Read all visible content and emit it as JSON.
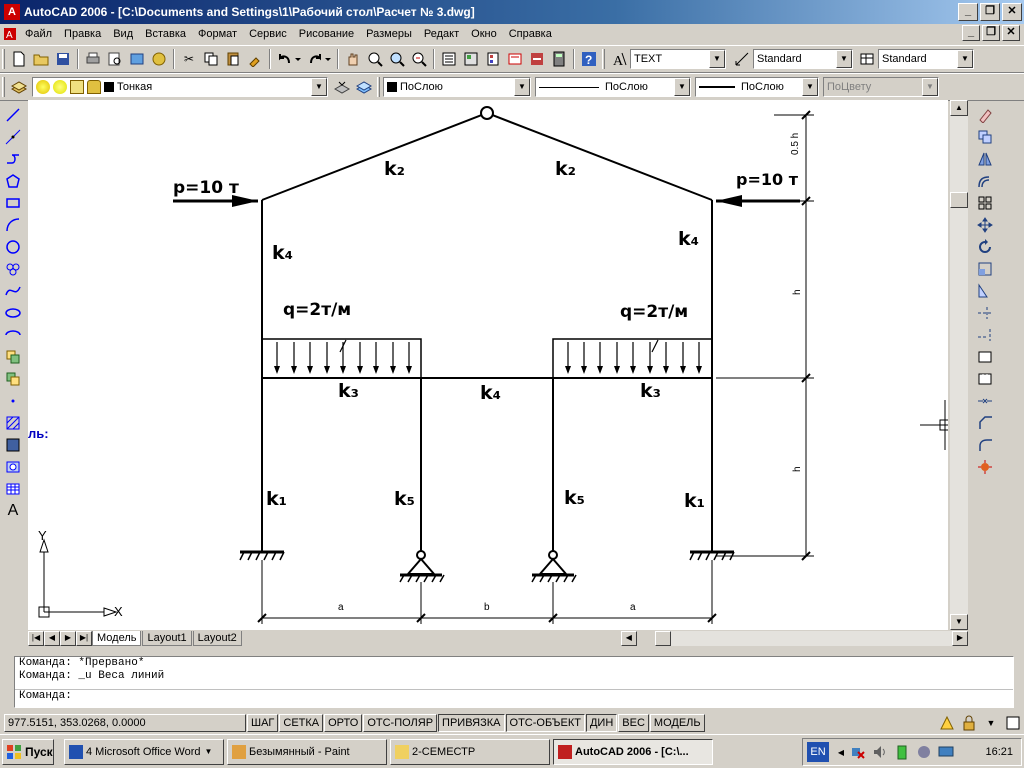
{
  "window": {
    "title": "AutoCAD 2006 - [C:\\Documents and Settings\\1\\Рабочий стол\\Расчет № 3.dwg]",
    "minimize": "_",
    "restore": "❐",
    "close": "✕"
  },
  "menu": [
    "Файл",
    "Правка",
    "Вид",
    "Вставка",
    "Формат",
    "Сервис",
    "Рисование",
    "Размеры",
    "Редакт",
    "Окно",
    "Справка"
  ],
  "toolbar": {
    "text_style": "TEXT",
    "dim_style": "Standard",
    "table_style": "Standard"
  },
  "layers": {
    "layer": "Тонкая",
    "color": "ПоСлою",
    "linetype": "ПоСлою",
    "lineweight": "ПоСлою",
    "plotstyle": "ПоЦвету"
  },
  "drawing": {
    "p_left": "p=10 т",
    "p_right": "p=10 т",
    "q_left": "q=2т/м",
    "q_right": "q=2т/м",
    "k2_left": "k₂",
    "k2_right": "k₂",
    "k4_left": "k₄",
    "k4_right": "k₄",
    "k4_mid": "k₄",
    "k3_left": "k₃",
    "k3_right": "k₃",
    "k1_left": "k₁",
    "k1_right": "k₁",
    "k5_left": "k₅",
    "k5_right": "k₅",
    "dim_05h": "0.5 h",
    "dim_h1": "h",
    "dim_h2": "h",
    "dim_a1": "a",
    "dim_b": "b",
    "dim_a2": "a",
    "ucs_y": "Y",
    "ucs_x": "X",
    "side_text": "ль:"
  },
  "tabs": [
    "Модель",
    "Layout1",
    "Layout2"
  ],
  "command": {
    "line1": "Команда: *Прервано*",
    "line2": "Команда: _u Веса линий",
    "prompt": "Команда:"
  },
  "status": {
    "coords": "977.5151, 353.0268, 0.0000",
    "buttons": [
      "ШАГ",
      "СЕТКА",
      "ОРТО",
      "ОТС-ПОЛЯР",
      "ПРИВЯЗКА",
      "ОТС-ОБЪЕКТ",
      "ДИН",
      "ВЕС",
      "МОДЕЛЬ"
    ]
  },
  "taskbar": {
    "start": "Пуск",
    "tasks": [
      "4 Microsoft Office Word",
      "Безымянный - Paint",
      "2-СЕМЕСТР",
      "AutoCAD 2006 - [C:\\..."
    ],
    "lang": "EN",
    "clock": "16:21"
  }
}
